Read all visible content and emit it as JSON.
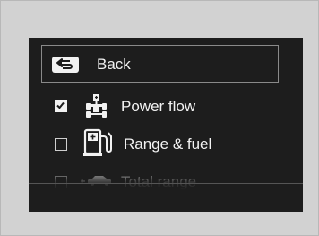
{
  "menu": {
    "back_label": "Back",
    "items": [
      {
        "label": "Power flow",
        "checked": true,
        "icon": "power-flow-icon"
      },
      {
        "label": "Range & fuel",
        "checked": false,
        "icon": "fuel-pump-icon"
      },
      {
        "label": "Total range",
        "checked": false,
        "icon": "car-icon"
      }
    ]
  },
  "colors": {
    "frame_background": "#d2d2d2",
    "screen_background": "#1d1d1d",
    "text": "#f2f2f2",
    "border": "#8a8a8a"
  }
}
